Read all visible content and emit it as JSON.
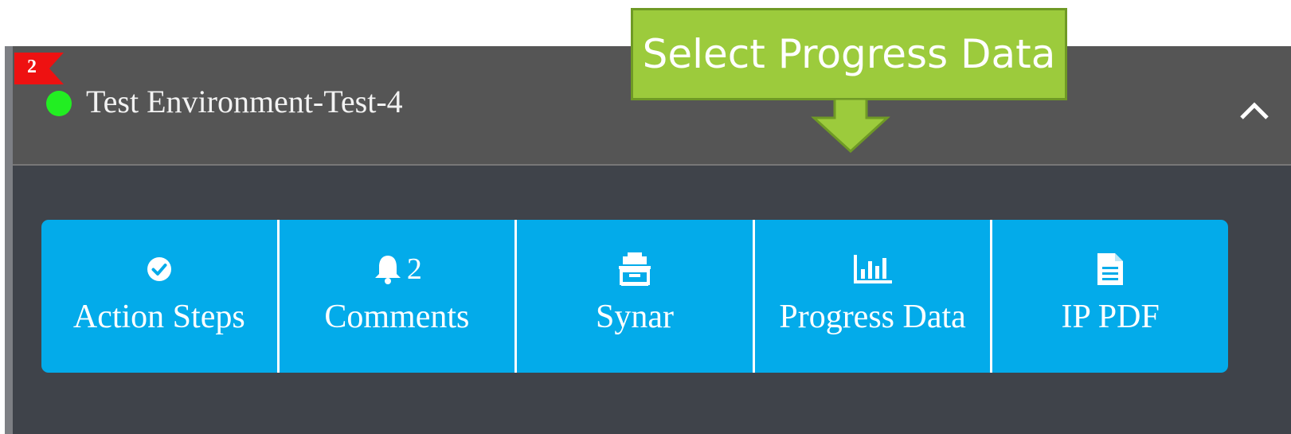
{
  "callout": {
    "text": "Select Progress Data"
  },
  "panel": {
    "flag_count": "2",
    "title": "Test Environment-Test-4",
    "status": "online",
    "status_color": "#22ee22",
    "collapse_icon": "chevron-up-icon"
  },
  "toolbar": {
    "accent_color": "#03abea",
    "items": [
      {
        "label": "Action Steps",
        "icon": "check-circle-icon",
        "count": ""
      },
      {
        "label": "Comments",
        "icon": "bell-icon",
        "count": "2"
      },
      {
        "label": "Synar",
        "icon": "synar-icon",
        "count": ""
      },
      {
        "label": "Progress Data",
        "icon": "bar-chart-icon",
        "count": ""
      },
      {
        "label": "IP PDF",
        "icon": "file-text-icon",
        "count": ""
      }
    ]
  }
}
